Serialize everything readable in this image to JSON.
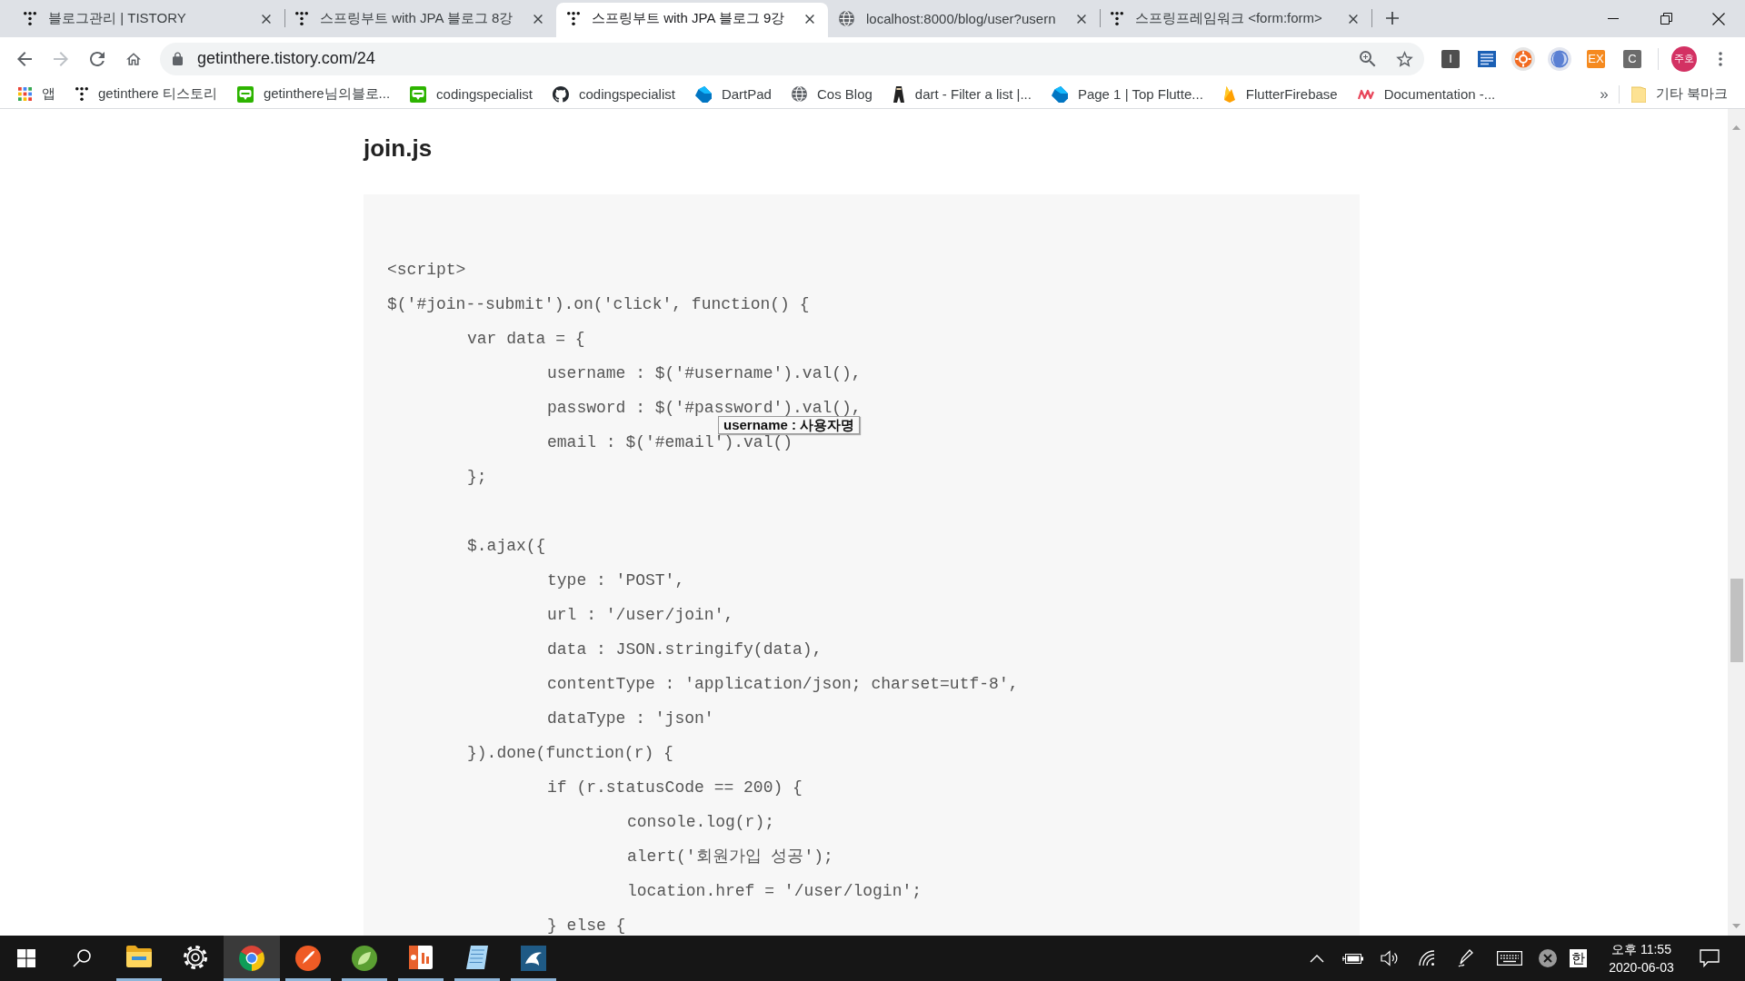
{
  "browser": {
    "tabs": [
      {
        "title": "블로그관리 | TISTORY",
        "kind": "tistory",
        "selected": false
      },
      {
        "title": "스프링부트 with JPA 블로그 8강",
        "kind": "tistory",
        "selected": false
      },
      {
        "title": "스프링부트 with JPA 블로그 9강",
        "kind": "tistory",
        "selected": true
      },
      {
        "title": "localhost:8000/blog/user?usern",
        "kind": "globe",
        "selected": false
      },
      {
        "title": "스프링프레임워크 <form:form>",
        "kind": "tistory",
        "selected": false
      }
    ],
    "navigation": [
      {
        "kind": "back",
        "disabled": false
      },
      {
        "kind": "forward",
        "disabled": true
      },
      {
        "kind": "reload",
        "disabled": false
      },
      {
        "kind": "home",
        "disabled": false
      }
    ],
    "address_bar": {
      "url": "getinthere.tistory.com/24"
    },
    "extensions": [
      {
        "kind": "letter",
        "label": "I",
        "color": "#4f4f4f"
      },
      {
        "kind": "dictionary"
      },
      {
        "kind": "ring"
      },
      {
        "kind": "lens"
      },
      {
        "kind": "letter",
        "label": "EX",
        "color": "#f58a1f"
      },
      {
        "kind": "letter",
        "label": "C",
        "color": "#6b6b6b"
      }
    ],
    "profile": {
      "initials": "주호"
    },
    "bookmarks": [
      {
        "label": "앱",
        "kind": "apps"
      },
      {
        "label": "getinthere 티스토리",
        "kind": "tistory"
      },
      {
        "label": "getinthere님의블로...",
        "kind": "blog"
      },
      {
        "label": "codingspecialist",
        "kind": "blog"
      },
      {
        "label": "codingspecialist",
        "kind": "github"
      },
      {
        "label": "DartPad",
        "kind": "dart"
      },
      {
        "label": "Cos Blog",
        "kind": "globe"
      },
      {
        "label": "dart - Filter a list |...",
        "kind": "figure"
      },
      {
        "label": "Page 1 | Top Flutte...",
        "kind": "dart"
      },
      {
        "label": "FlutterFirebase",
        "kind": "flame"
      },
      {
        "label": "Documentation -...",
        "kind": "zigzag"
      }
    ],
    "bookmarks_overflow": "»",
    "other_bookmarks": {
      "label": "기타 북마크"
    }
  },
  "page": {
    "heading": "join.js",
    "code_groups": [
      [
        "<script>",
        "$('#join--submit').on('click', function() {",
        "\tvar data = {",
        "\t\tusername : $('#username').val(),",
        "\t\tpassword : $('#password').val(),",
        "\t\temail : $('#email').val()",
        "\t};"
      ],
      [
        "\t$.ajax({",
        "\t\ttype : 'POST',",
        "\t\turl : '/user/join',",
        "\t\tdata : JSON.stringify(data),",
        "\t\tcontentType : 'application/json; charset=utf-8',",
        "\t\tdataType : 'json'",
        "\t}).done(function(r) {",
        "\t\tif (r.statusCode == 200) {",
        "\t\t\tconsole.log(r);",
        "\t\t\talert('회원가입 성공');",
        "\t\t\tlocation.href = '/user/login';",
        "\t\t} else {"
      ]
    ],
    "tooltip": "username : 사용자명"
  },
  "taskbar": {
    "apps": [
      {
        "kind": "folder",
        "running": true,
        "selected": false
      },
      {
        "kind": "gear",
        "running": false,
        "selected": false
      },
      {
        "kind": "tricolor",
        "running": true,
        "selected": true
      },
      {
        "kind": "feather",
        "running": true,
        "selected": false
      },
      {
        "kind": "leaf",
        "running": true,
        "selected": false
      },
      {
        "kind": "chart",
        "running": true,
        "selected": false
      },
      {
        "kind": "notepad",
        "running": true,
        "selected": false
      },
      {
        "kind": "tile",
        "running": true,
        "selected": false
      }
    ],
    "input_mode": "한",
    "time": "오후 11:55",
    "date": "2020-06-03"
  }
}
